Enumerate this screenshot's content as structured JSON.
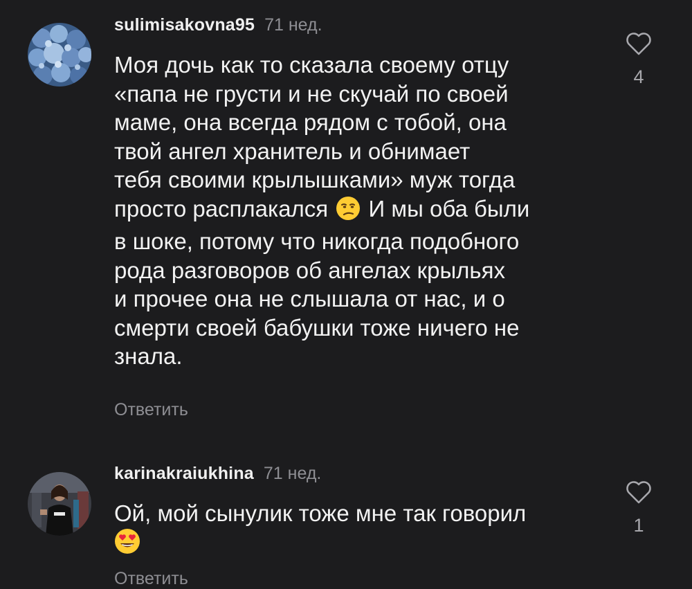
{
  "comments": [
    {
      "username": "sulimisakovna95",
      "time": "71 нед.",
      "lines": [
        "Моя дочь как то сказала своему отцу",
        "«папа  не грусти и не скучай по своей",
        "маме, она всегда рядом с тобой, она",
        "твой ангел хранитель и обнимает",
        "тебя своими крылышками» муж тогда",
        "просто расплакался",
        "И мы оба были",
        "в шоке, потому что никогда подобного",
        "рода разговоров об ангелах крыльях",
        "и прочее она не слышала от нас, и о",
        "смерти своей бабушки тоже ничего не",
        "знала."
      ],
      "emoji": "unamused-face-icon",
      "reply_label": "Ответить",
      "like_count": "4"
    },
    {
      "username": "karinakraiukhina",
      "time": "71 нед.",
      "lines": [
        "Ой, мой сынулик тоже мне так говорил"
      ],
      "emoji": "heart-eyes-face-icon",
      "reply_label": "Ответить",
      "like_count": "1"
    }
  ],
  "colors": {
    "background": "#1c1c1e",
    "text": "#f2f2f2",
    "secondary": "#8e8e93",
    "emoji_yellow": "#ffcc33",
    "heart_red": "#e8253c"
  }
}
